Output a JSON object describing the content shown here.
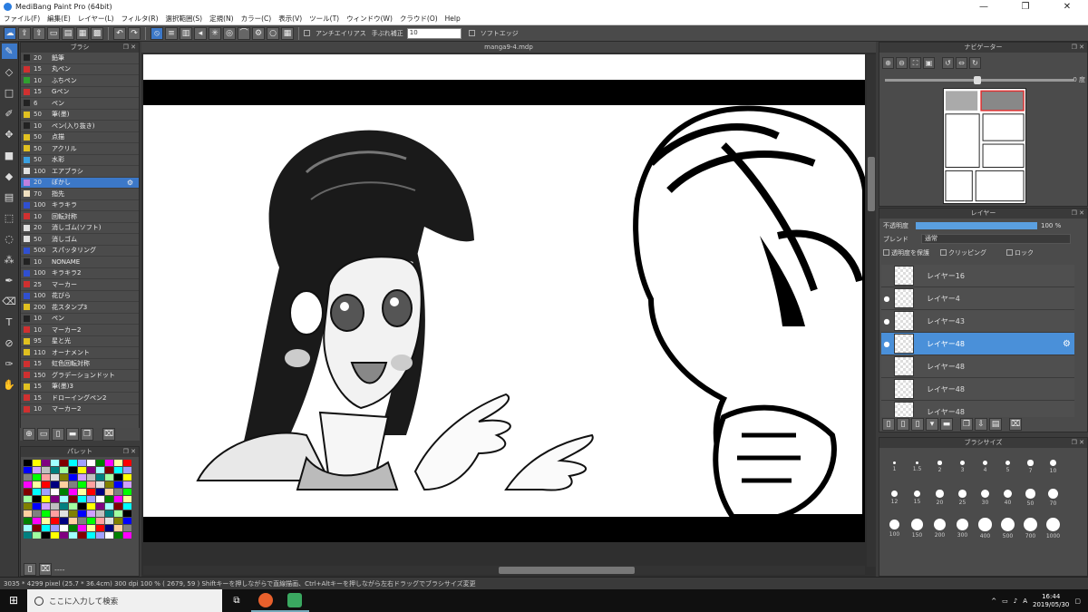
{
  "app": {
    "title": "MediBang Paint Pro (64bit)",
    "controls": [
      "—",
      "❐",
      "✕"
    ]
  },
  "menu": [
    "ファイル(F)",
    "編集(E)",
    "レイヤー(L)",
    "フィルタ(R)",
    "選択範囲(S)",
    "定規(N)",
    "カラー(C)",
    "表示(V)",
    "ツール(T)",
    "ウィンドウ(W)",
    "クラウド(O)",
    "Help"
  ],
  "toolbar": {
    "antialias_label": "アンチエイリアス",
    "stabilizer_label": "手ぶれ補正",
    "stabilizer_value": "10",
    "soft_edge_label": "ソフトエッジ"
  },
  "document": {
    "tab": "manga9-4.mdp"
  },
  "brush_panel": {
    "title": "ブラシ",
    "items": [
      {
        "size": "20",
        "name": "鉛筆",
        "color": "#222222"
      },
      {
        "size": "15",
        "name": "丸ペン",
        "color": "#d03030"
      },
      {
        "size": "10",
        "name": "ふちペン",
        "color": "#30a030"
      },
      {
        "size": "15",
        "name": "Gペン",
        "color": "#d03030"
      },
      {
        "size": "6",
        "name": "ペン",
        "color": "#222222"
      },
      {
        "size": "50",
        "name": "筆(墨)",
        "color": "#e0c020"
      },
      {
        "size": "10",
        "name": "ペン(入り抜き)",
        "color": "#222222"
      },
      {
        "size": "50",
        "name": "点描",
        "color": "#e0c020"
      },
      {
        "size": "50",
        "name": "アクリル",
        "color": "#e0c020"
      },
      {
        "size": "50",
        "name": "水彩",
        "color": "#3aa0e0"
      },
      {
        "size": "100",
        "name": "エアブラシ",
        "color": "#e0e0e0"
      },
      {
        "size": "20",
        "name": "ぼかし",
        "color": "#c080e0"
      },
      {
        "size": "70",
        "name": "指先",
        "color": "#f0e0c0"
      },
      {
        "size": "100",
        "name": "キラキラ",
        "color": "#3050d0"
      },
      {
        "size": "10",
        "name": "回転対称",
        "color": "#d03030"
      },
      {
        "size": "20",
        "name": "消しゴム(ソフト)",
        "color": "#e0e0e0"
      },
      {
        "size": "50",
        "name": "消しゴム",
        "color": "#e0e0e0"
      },
      {
        "size": "500",
        "name": "スパッタリング",
        "color": "#3050d0"
      },
      {
        "size": "10",
        "name": "NONAME",
        "color": "#222222"
      },
      {
        "size": "100",
        "name": "キラキラ2",
        "color": "#3050d0"
      },
      {
        "size": "25",
        "name": "マーカー",
        "color": "#d03030"
      },
      {
        "size": "100",
        "name": "花びら",
        "color": "#3050d0"
      },
      {
        "size": "200",
        "name": "花スタンプ3",
        "color": "#e0c020"
      },
      {
        "size": "10",
        "name": "ペン",
        "color": "#222222"
      },
      {
        "size": "10",
        "name": "マーカー2",
        "color": "#d03030"
      },
      {
        "size": "95",
        "name": "星と光",
        "color": "#e0c020"
      },
      {
        "size": "110",
        "name": "オーナメント",
        "color": "#e0c020"
      },
      {
        "size": "15",
        "name": "虹色回転対称",
        "color": "#d03030"
      },
      {
        "size": "150",
        "name": "グラデーションドット",
        "color": "#d03030"
      },
      {
        "size": "15",
        "name": "筆(墨)3",
        "color": "#e0c020"
      },
      {
        "size": "15",
        "name": "ドローイングペン2",
        "color": "#d03030"
      },
      {
        "size": "10",
        "name": "マーカー2",
        "color": "#d03030"
      }
    ],
    "selected_index": 11
  },
  "palette": {
    "title": "パレット",
    "footer_text": "----"
  },
  "navigator": {
    "title": "ナビゲーター",
    "angle": "0 度"
  },
  "layer_panel": {
    "title": "レイヤー",
    "opacity_label": "不透明度",
    "opacity_value": "100 %",
    "opacity_fraction": 1.0,
    "blend_label": "ブレンド",
    "blend_value": "通常",
    "protect_label": "透明度を保護",
    "clipping_label": "クリッピング",
    "lock_label": "ロック",
    "layers": [
      {
        "name": "レイヤー16",
        "visible": false
      },
      {
        "name": "レイヤー4",
        "visible": true
      },
      {
        "name": "レイヤー43",
        "visible": true
      },
      {
        "name": "レイヤー48",
        "visible": true,
        "selected": true
      },
      {
        "name": "レイヤー48",
        "visible": false
      },
      {
        "name": "レイヤー48",
        "visible": false
      },
      {
        "name": "レイヤー48",
        "visible": false
      }
    ]
  },
  "brush_size": {
    "title": "ブラシサイズ",
    "sizes": [
      "1",
      "1.5",
      "2",
      "3",
      "4",
      "5",
      "7",
      "10",
      "12",
      "15",
      "20",
      "25",
      "30",
      "40",
      "50",
      "70",
      "100",
      "150",
      "200",
      "300",
      "400",
      "500",
      "700",
      "1000"
    ]
  },
  "status": {
    "text": "3035 * 4299 pixel   (25.7 * 36.4cm)   300 dpi   100 %   ( 2679, 59 )   Shiftキーを押しながらで直線描画、Ctrl+Altキーを押しながら左右ドラッグでブラシサイズ変更"
  },
  "taskbar": {
    "search_placeholder": "ここに入力して検索",
    "time": "16:44",
    "date": "2019/05/30"
  }
}
